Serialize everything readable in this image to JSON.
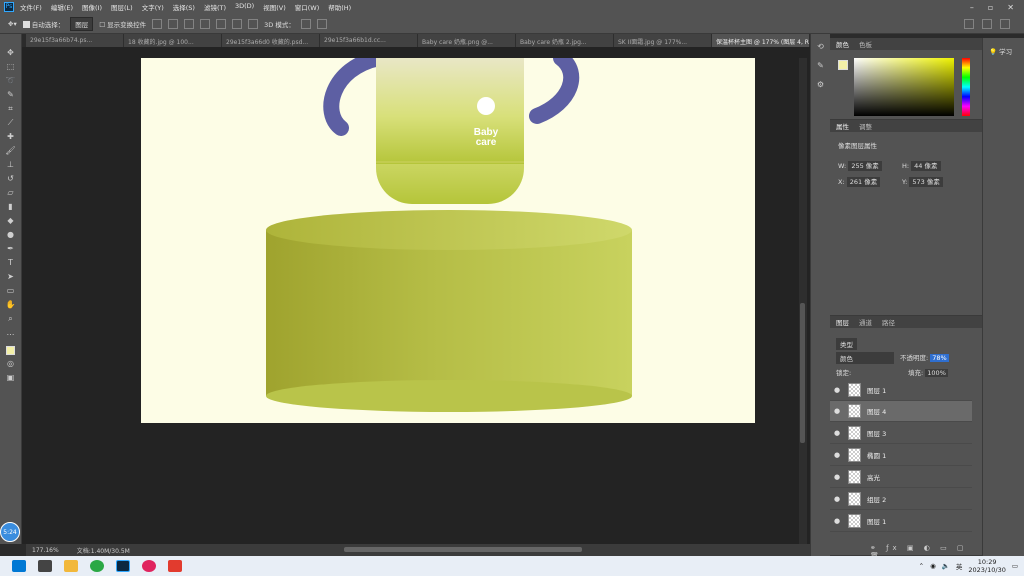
{
  "menubar": {
    "items": [
      "文件(F)",
      "编辑(E)",
      "图像(I)",
      "图层(L)",
      "文字(Y)",
      "选择(S)",
      "滤镜(T)",
      "3D(D)",
      "视图(V)",
      "窗口(W)",
      "帮助(H)"
    ],
    "win_min": "–",
    "win_max": "▫",
    "win_close": "✕"
  },
  "options": {
    "auto_select_label": "自动选择：",
    "auto_select_value": "图层",
    "show_transform": "显示变换控件",
    "mode_3d": "3D 模式："
  },
  "tabs": [
    "29e15f3a66b74.ps...",
    "18 收藏的.jpg @ 100...",
    "29e15f3a66d0 收藏的.psd...",
    "29e15f3a66b1d.cc...",
    "Baby care 奶瓶.png @...",
    "Baby care 奶瓶 2.jpg...",
    "SK II面霜.jpg @ 177%...",
    "保温杯杯主图 @ 177% (图层 4, RGB/8#) *"
  ],
  "doc": {
    "brand_line1": "Baby",
    "brand_line2": "care"
  },
  "color_panel": {
    "tab1": "颜色",
    "tab2": "色板",
    "fg_color": "#f3f0a8"
  },
  "properties": {
    "tab1": "属性",
    "tab2": "调整",
    "layer_kind": "像素图层属性",
    "w_label": "W:",
    "w_value": "255 像素",
    "h_label": "H:",
    "h_value": "44 像素",
    "x_label": "X:",
    "x_value": "261 像素",
    "y_label": "Y:",
    "y_value": "573 像素"
  },
  "layers_panel": {
    "tab1": "图层",
    "tab2": "通道",
    "tab3": "路径",
    "filter_label": "类型",
    "blend_mode": "颜色",
    "opacity_label": "不透明度:",
    "opacity_value": "78%",
    "lock_label": "锁定:",
    "fill_label": "填充:",
    "fill_value": "100%",
    "layers": [
      {
        "name": "图层 1",
        "selected": false
      },
      {
        "name": "图层 4",
        "selected": true
      },
      {
        "name": "图层 3",
        "selected": false
      },
      {
        "name": "椭圆 1",
        "selected": false
      },
      {
        "name": "高光",
        "selected": false
      },
      {
        "name": "组层 2",
        "selected": false
      },
      {
        "name": "图层 1",
        "selected": false
      }
    ]
  },
  "learn": {
    "label": "学习"
  },
  "status": {
    "zoom": "177.16%",
    "doc_size": "文档:1.40M/30.5M"
  },
  "taskbar": {
    "time": "10:29",
    "date": "2023/10/30",
    "ime": "英",
    "bubble_time": "5:24"
  }
}
